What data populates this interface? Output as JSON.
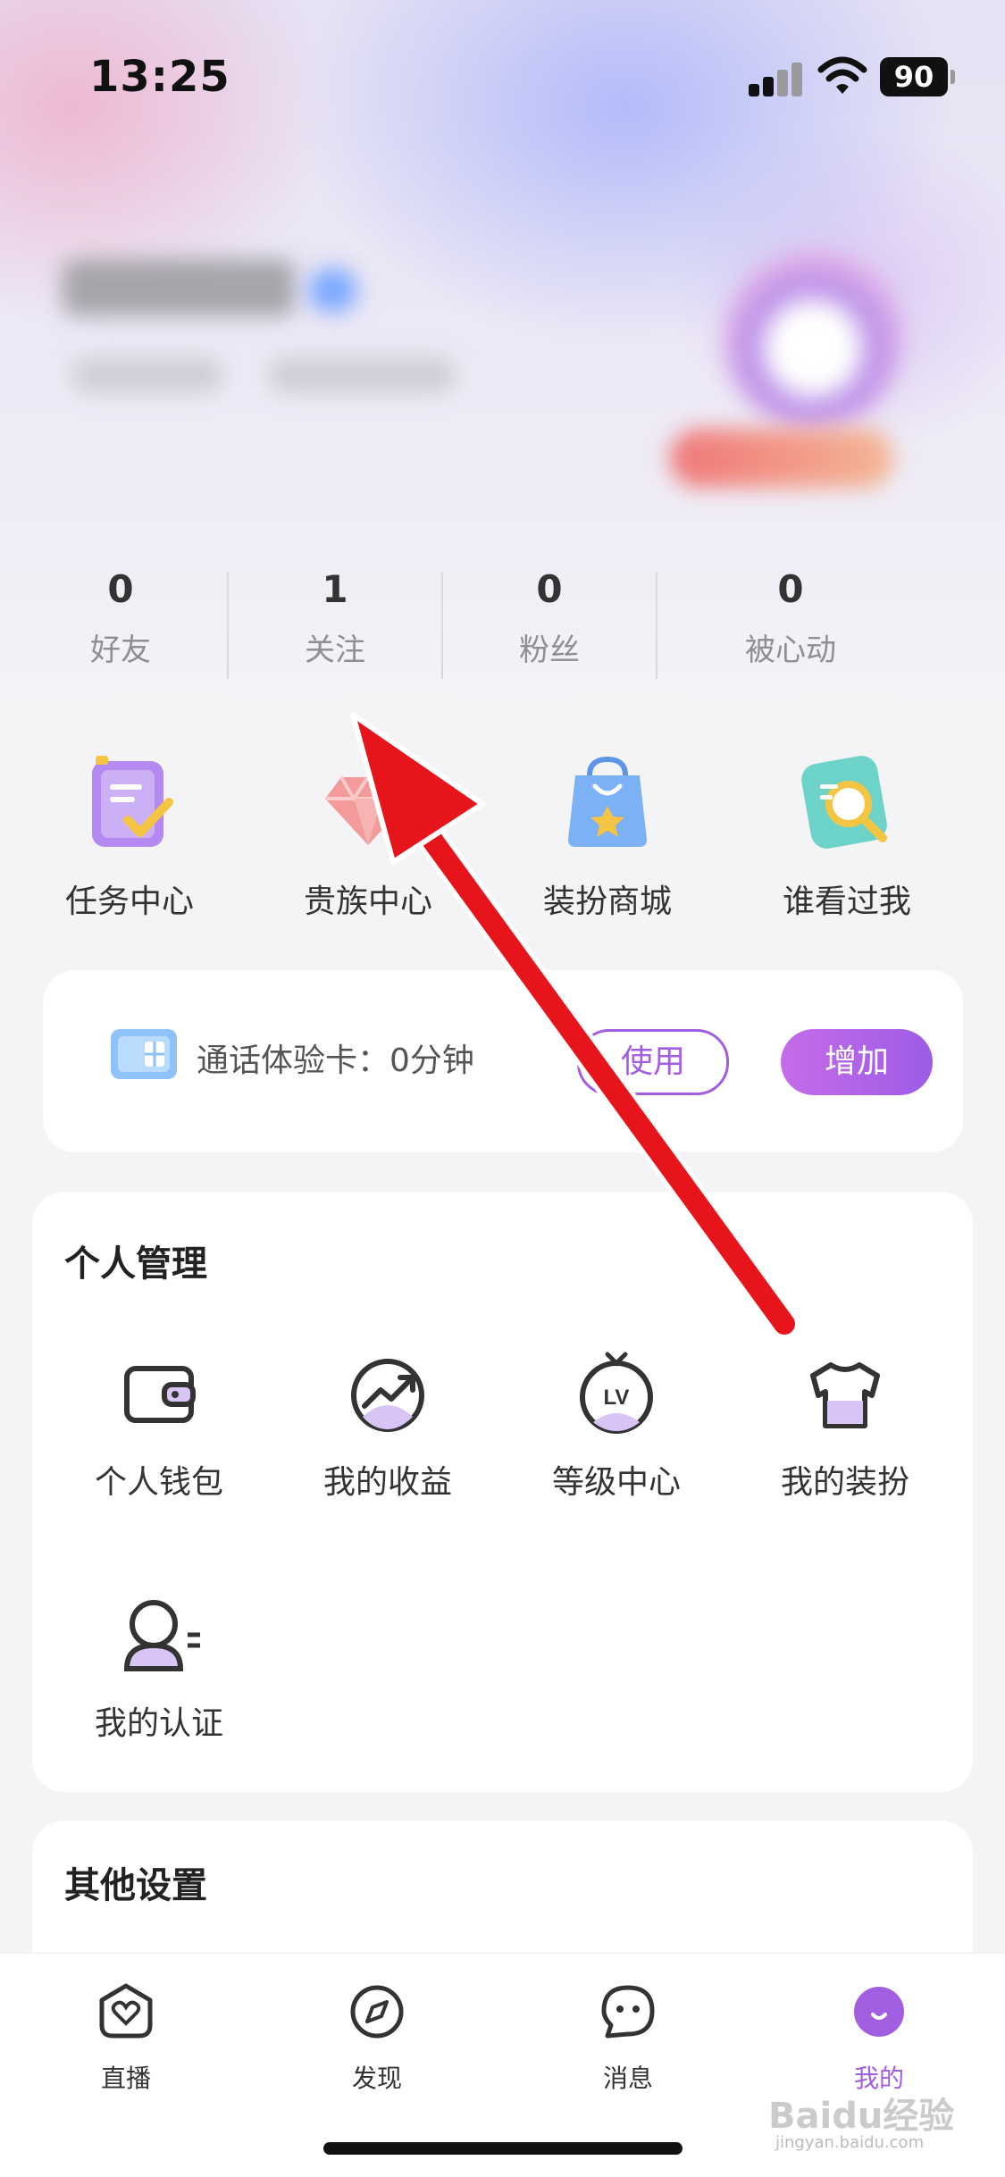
{
  "status_bar": {
    "time": "13:25",
    "battery": "90"
  },
  "stats": [
    {
      "value": "0",
      "label": "好友"
    },
    {
      "value": "1",
      "label": "关注"
    },
    {
      "value": "0",
      "label": "粉丝"
    },
    {
      "value": "0",
      "label": "被心动"
    }
  ],
  "features": [
    {
      "label": "任务中心",
      "icon": "task-icon"
    },
    {
      "label": "贵族中心",
      "icon": "diamond-icon"
    },
    {
      "label": "装扮商城",
      "icon": "shopping-bag-icon"
    },
    {
      "label": "谁看过我",
      "icon": "magnifier-icon"
    }
  ],
  "call_card": {
    "text": "通话体验卡：0分钟",
    "use_label": "使用",
    "add_label": "增加"
  },
  "personal": {
    "title": "个人管理",
    "items": [
      {
        "label": "个人钱包",
        "icon": "wallet-icon"
      },
      {
        "label": "我的收益",
        "icon": "earnings-icon"
      },
      {
        "label": "等级中心",
        "icon": "level-icon"
      },
      {
        "label": "我的装扮",
        "icon": "outfit-icon"
      },
      {
        "label": "我的认证",
        "icon": "verify-icon"
      }
    ]
  },
  "other": {
    "title": "其他设置"
  },
  "tabs": [
    {
      "label": "直播",
      "icon": "live-icon"
    },
    {
      "label": "发现",
      "icon": "compass-icon"
    },
    {
      "label": "消息",
      "icon": "message-icon"
    },
    {
      "label": "我的",
      "icon": "profile-icon",
      "active": true
    }
  ],
  "colors": {
    "accent": "#a15ee0",
    "annotation_arrow": "#e8141b"
  },
  "watermark": {
    "text": "Baidu经验",
    "sub": "jingyan.baidu.com"
  }
}
